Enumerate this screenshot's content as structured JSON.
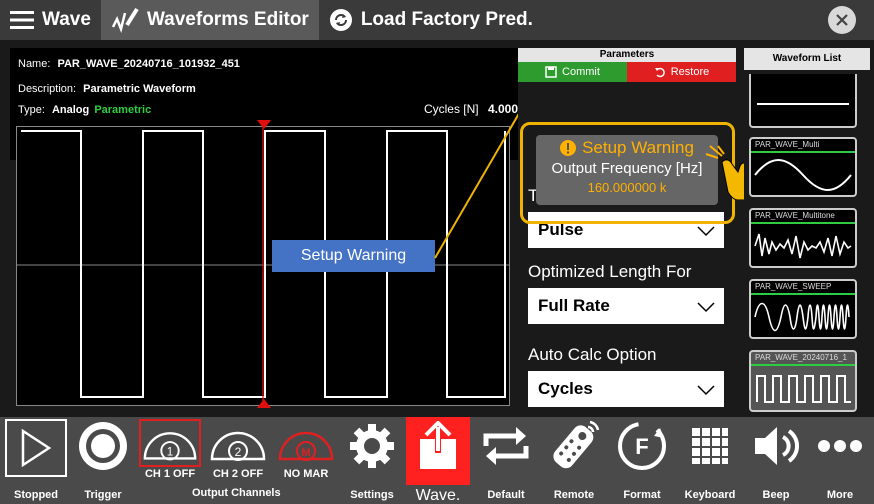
{
  "topbar": {
    "wave_label": "Wave",
    "editor_label": "Waveforms Editor",
    "load_label": "Load Factory Pred."
  },
  "info": {
    "name_label": "Name:",
    "name_value": "PAR_WAVE_20240716_101932_451",
    "desc_label": "Description:",
    "desc_value": "Parametric Waveform",
    "type_label": "Type:",
    "type_value": "Analog",
    "type_sub": "Parametric",
    "cycles_label": "Cycles [N]",
    "cycles_value": "4.000"
  },
  "params": {
    "header": "Parameters",
    "commit": "Commit",
    "restore": "Restore",
    "type_label": "Type",
    "type_value": "Pulse",
    "optlen_label": "Optimized Length For",
    "optlen_value": "Full Rate",
    "autocalc_label": "Auto Calc Option",
    "autocalc_value": "Cycles"
  },
  "warning": {
    "title": "Setup Warning",
    "sub": "Output Frequency [Hz]",
    "value": "160.000000 k"
  },
  "callout": {
    "text": "Setup Warning"
  },
  "wlist": {
    "header": "Waveform List",
    "items": [
      "PAR_WAVE_Multi",
      "PAR_WAVE_Multitone",
      "PAR_WAVE_SWEEP",
      "PAR_WAVE_20240716_1"
    ]
  },
  "bottom": {
    "stopped": "Stopped",
    "trigger": "Trigger",
    "ch1": "CH 1 OFF",
    "ch2": "CH 2 OFF",
    "nomar": "NO MAR",
    "output_channels": "Output Channels",
    "settings": "Settings",
    "wavelist": "Wave. List",
    "default": "Default",
    "remote": "Remote",
    "format": "Format",
    "keyboard": "Keyboard",
    "beep": "Beep",
    "more": "More",
    "ch1_num": "1",
    "ch2_num": "2",
    "mar_letter": "M",
    "format_letter": "F"
  },
  "colors": {
    "accent_green": "#2ecc40",
    "warning_orange": "#f0b400",
    "callout_blue": "#4472c4",
    "restore_red": "#e02020"
  }
}
